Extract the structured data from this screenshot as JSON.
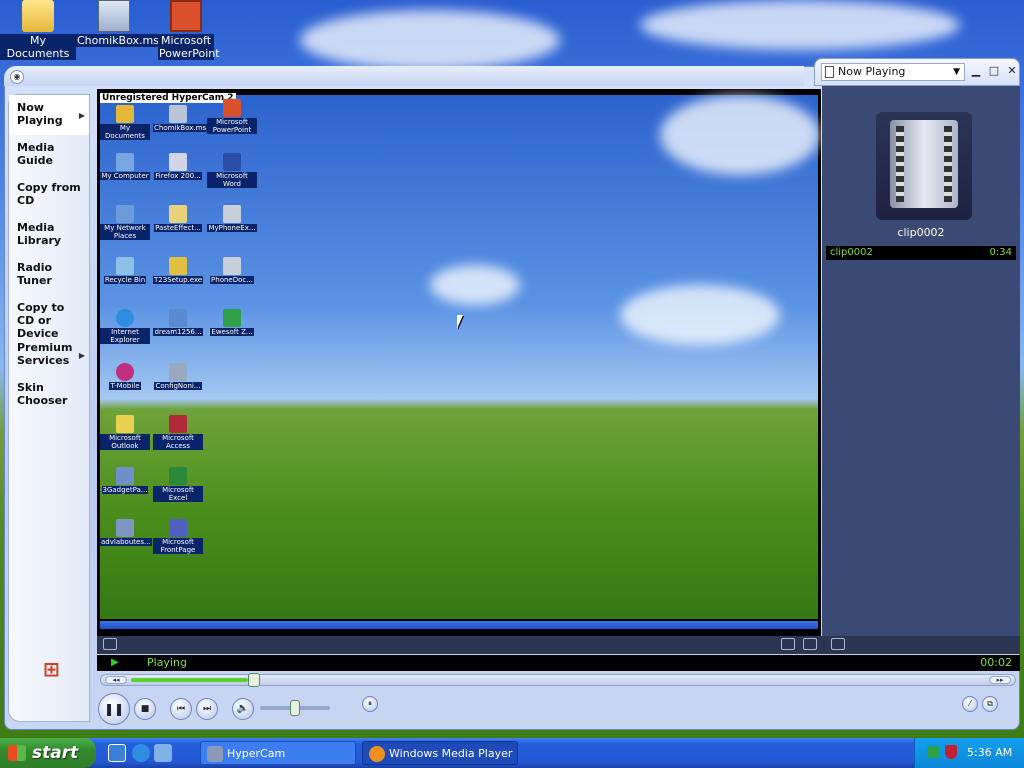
{
  "desktop_icons": [
    {
      "label": "My Documents"
    },
    {
      "label": "ChomikBox.msi"
    },
    {
      "label": "Microsoft PowerPoint"
    }
  ],
  "wmp": {
    "taskpane": [
      {
        "label": "Now Playing"
      },
      {
        "label": "Media Guide"
      },
      {
        "label": "Copy from CD"
      },
      {
        "label": "Media Library"
      },
      {
        "label": "Radio Tuner"
      },
      {
        "label": "Copy to CD or Device"
      },
      {
        "label": "Premium Services"
      },
      {
        "label": "Skin Chooser"
      }
    ],
    "playlist_dropdown": "Now Playing",
    "clip_title": "clip0002",
    "playlist_items": [
      {
        "name": "clip0002",
        "duration": "0:34"
      }
    ],
    "status_text": "Playing",
    "elapsed_time": "00:02",
    "seek_progress": 0.06,
    "volume_level": 0.5
  },
  "video_content": {
    "watermark": "Unregistered HyperCam 2",
    "icons": [
      {
        "label": "My Documents"
      },
      {
        "label": "ChomikBox.ms"
      },
      {
        "label": "Microsoft PowerPoint"
      },
      {
        "label": "My Computer"
      },
      {
        "label": "Firefox 200..."
      },
      {
        "label": "Microsoft Word"
      },
      {
        "label": "My Network Places"
      },
      {
        "label": "PasteEffect..."
      },
      {
        "label": "MyPhoneEx..."
      },
      {
        "label": "Recycle Bin"
      },
      {
        "label": "T23Setup.exe"
      },
      {
        "label": "PhoneDoc..."
      },
      {
        "label": "Internet Explorer"
      },
      {
        "label": "dream1256..."
      },
      {
        "label": "Ewesoft Z..."
      },
      {
        "label": "T-Mobile"
      },
      {
        "label": "ConfigNoni..."
      },
      {
        "label": "Microsoft Outlook"
      },
      {
        "label": "Microsoft Access"
      },
      {
        "label": "3GadgetPa..."
      },
      {
        "label": "Microsoft Excel"
      },
      {
        "label": "advlaboutes..."
      },
      {
        "label": "Microsoft FrontPage"
      }
    ]
  },
  "taskbar": {
    "start_label": "start",
    "tasks": [
      {
        "label": "HyperCam"
      },
      {
        "label": "Windows Media Player"
      }
    ],
    "clock": "5:36 AM"
  }
}
